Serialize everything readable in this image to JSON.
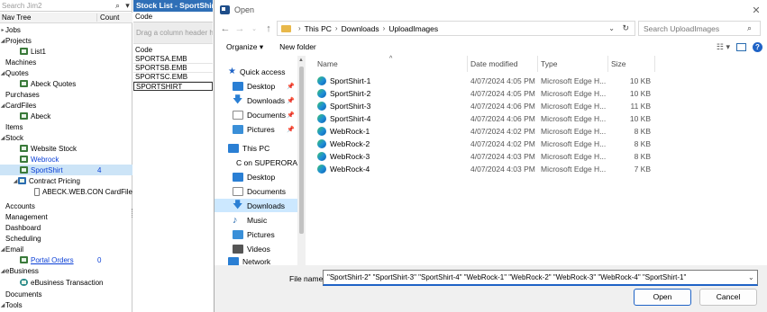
{
  "left": {
    "search_placeholder": "Search Jim2",
    "header": {
      "col1": "Nav Tree",
      "col2": "Count"
    },
    "items": [
      {
        "label": "Jobs",
        "arrow": "▸"
      },
      {
        "label": "Projects",
        "arrow": "◢"
      },
      {
        "label": "List1"
      },
      {
        "label": "Machines"
      },
      {
        "label": "Quotes",
        "arrow": "◢"
      },
      {
        "label": "Abeck Quotes"
      },
      {
        "label": "Purchases"
      },
      {
        "label": "CardFiles",
        "arrow": "◢"
      },
      {
        "label": "Abeck"
      },
      {
        "label": "Items"
      },
      {
        "label": "Stock",
        "arrow": "◢"
      },
      {
        "label": "Website Stock"
      },
      {
        "label": "Webrock"
      },
      {
        "label": "SportShirt",
        "count": "4"
      },
      {
        "label": "Contract Pricing",
        "arrow": "◢"
      },
      {
        "label": "ABECK.WEB.CON CardFile"
      },
      {
        "label": "Accounts"
      },
      {
        "label": "Management"
      },
      {
        "label": "Dashboard"
      },
      {
        "label": "Scheduling"
      },
      {
        "label": "Email",
        "arrow": "◢"
      },
      {
        "label": "Portal Orders",
        "count": "0"
      },
      {
        "label": "eBusiness",
        "arrow": "◢"
      },
      {
        "label": "eBusiness Transaction"
      },
      {
        "label": "Documents"
      },
      {
        "label": "Tools",
        "arrow": "◢"
      }
    ]
  },
  "stock": {
    "title": "Stock List - SportShirt",
    "code_label": "Code",
    "group_hint": "Drag a column header here",
    "col_label": "Code",
    "rows": [
      "SPORTSA.EMB",
      "SPORTSB.EMB",
      "SPORTSC.EMB",
      "SPORTSHIRT"
    ]
  },
  "dialog": {
    "title": "Open",
    "close": "✕",
    "path": [
      "This PC",
      "Downloads",
      "UploadImages"
    ],
    "search_placeholder": "Search UploadImages",
    "organize": "Organize ▾",
    "new_folder": "New folder",
    "nav": [
      {
        "label": "Quick access",
        "color": "#1f63c6"
      },
      {
        "label": "Desktop",
        "color": "#2a7fd4",
        "pin": true
      },
      {
        "label": "Downloads",
        "color": "#2a7fd4",
        "pin": true
      },
      {
        "label": "Documents",
        "color": "#8a8a8a",
        "pin": true
      },
      {
        "label": "Pictures",
        "color": "#3a8fd8",
        "pin": true
      },
      {
        "label": "This PC",
        "color": "#2a7fd4"
      },
      {
        "label": "C on SUPERORA",
        "color": "#6a6a6a"
      },
      {
        "label": "Desktop",
        "color": "#2a7fd4"
      },
      {
        "label": "Documents",
        "color": "#8a8a8a"
      },
      {
        "label": "Downloads",
        "color": "#2a7fd4"
      },
      {
        "label": "Music",
        "color": "#2a6cb0"
      },
      {
        "label": "Pictures",
        "color": "#3a8fd8"
      },
      {
        "label": "Videos",
        "color": "#555555"
      },
      {
        "label": "Network",
        "color": "#2a7fd4"
      }
    ],
    "columns": {
      "name": "Name",
      "date": "Date modified",
      "type": "Type",
      "size": "Size"
    },
    "files": [
      {
        "name": "SportShirt-1",
        "date": "4/07/2024 4:05 PM",
        "type": "Microsoft Edge H...",
        "size": "10 KB"
      },
      {
        "name": "SportShirt-2",
        "date": "4/07/2024 4:05 PM",
        "type": "Microsoft Edge H...",
        "size": "10 KB"
      },
      {
        "name": "SportShirt-3",
        "date": "4/07/2024 4:06 PM",
        "type": "Microsoft Edge H...",
        "size": "11 KB"
      },
      {
        "name": "SportShirt-4",
        "date": "4/07/2024 4:06 PM",
        "type": "Microsoft Edge H...",
        "size": "10 KB"
      },
      {
        "name": "WebRock-1",
        "date": "4/07/2024 4:02 PM",
        "type": "Microsoft Edge H...",
        "size": "8 KB"
      },
      {
        "name": "WebRock-2",
        "date": "4/07/2024 4:02 PM",
        "type": "Microsoft Edge H...",
        "size": "8 KB"
      },
      {
        "name": "WebRock-3",
        "date": "4/07/2024 4:03 PM",
        "type": "Microsoft Edge H...",
        "size": "8 KB"
      },
      {
        "name": "WebRock-4",
        "date": "4/07/2024 4:03 PM",
        "type": "Microsoft Edge H...",
        "size": "7 KB"
      }
    ],
    "file_name_label": "File name:",
    "file_name_value": "\"SportShirt-2\" \"SportShirt-3\" \"SportShirt-4\" \"WebRock-1\" \"WebRock-2\" \"WebRock-3\" \"WebRock-4\" \"SportShirt-1\"",
    "open_label": "Open",
    "cancel_label": "Cancel"
  }
}
